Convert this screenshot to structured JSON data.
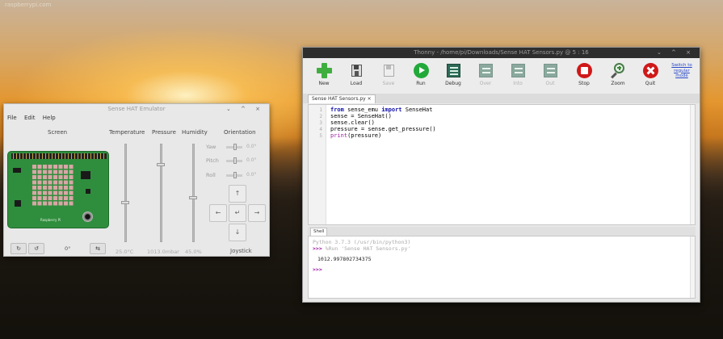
{
  "desktop": {
    "corner_text": "raspberrypi.com"
  },
  "sensehat": {
    "title": "Sense HAT Emulator",
    "window_controls": "⌄ ^ ×",
    "menu": [
      "File",
      "Edit",
      "Help"
    ],
    "columns": {
      "screen": "Screen",
      "temperature": "Temperature",
      "pressure": "Pressure",
      "humidity": "Humidity",
      "orientation": "Orientation"
    },
    "sensors": {
      "temperature": {
        "value_text": "25.0°C",
        "level": 0.4
      },
      "pressure": {
        "value_text": "1013.0mbar",
        "level": 0.8
      },
      "humidity": {
        "value_text": "45.0%",
        "level": 0.45
      }
    },
    "orientation": [
      {
        "label": "Yaw",
        "value": "0.0°"
      },
      {
        "label": "Pitch",
        "value": "0.0°"
      },
      {
        "label": "Roll",
        "value": "0.0°"
      }
    ],
    "joystick": {
      "up": "↑",
      "left": "←",
      "center": "↵",
      "right": "→",
      "down": "↓",
      "label": "Joystick"
    },
    "bottom": {
      "rotate_cw": "↻",
      "rotate_ccw": "↺",
      "rotation_value": "0°",
      "flip": "⇆"
    },
    "board_logo": "Raspberry Pi",
    "colors": {
      "board": "#2f8e3d",
      "leds": "#d9a6a6"
    }
  },
  "thonny": {
    "title": "Thonny  -  /home/pi/Downloads/Sense HAT Sensors.py  @  5 : 16",
    "window_controls": "⌄ ^ ×",
    "toolbar": [
      {
        "label": "New",
        "icon": "new-plus-icon",
        "enabled": true
      },
      {
        "label": "Load",
        "icon": "load-floppy-icon",
        "enabled": true
      },
      {
        "label": "Save",
        "icon": "save-floppy-icon",
        "enabled": false
      },
      {
        "label": "Run",
        "icon": "run-play-icon",
        "enabled": true
      },
      {
        "label": "Debug",
        "icon": "debug-icon",
        "enabled": true
      },
      {
        "label": "Over",
        "icon": "step-over-icon",
        "enabled": false
      },
      {
        "label": "Into",
        "icon": "step-into-icon",
        "enabled": false
      },
      {
        "label": "Out",
        "icon": "step-out-icon",
        "enabled": false
      },
      {
        "label": "Stop",
        "icon": "stop-icon",
        "enabled": true
      },
      {
        "label": "Zoom",
        "icon": "zoom-icon",
        "enabled": true
      },
      {
        "label": "Quit",
        "icon": "quit-icon",
        "enabled": true
      }
    ],
    "switch_mode": "Switch to regular mode",
    "tab": "Sense HAT Sensors.py ×",
    "code": [
      {
        "n": "1",
        "text": "from sense_emu import SenseHat"
      },
      {
        "n": "2",
        "text": "sense = SenseHat()"
      },
      {
        "n": "3",
        "text": "sense.clear()"
      },
      {
        "n": "4",
        "text": "pressure = sense.get_pressure()"
      },
      {
        "n": "5",
        "text": "print(pressure)"
      }
    ],
    "shell": {
      "tab": "Shell",
      "version_line": "Python 3.7.3 (/usr/bin/python3)",
      "run_prompt": ">>>",
      "run_cmd": " %Run 'Sense HAT Sensors.py'",
      "output": "1012.997802734375",
      "final_prompt": ">>>"
    },
    "colors": {
      "run": "#22a93a",
      "stop": "#d01818",
      "new": "#3fae3f",
      "keyword": "#1010aa",
      "builtin": "#9b1da0"
    }
  }
}
